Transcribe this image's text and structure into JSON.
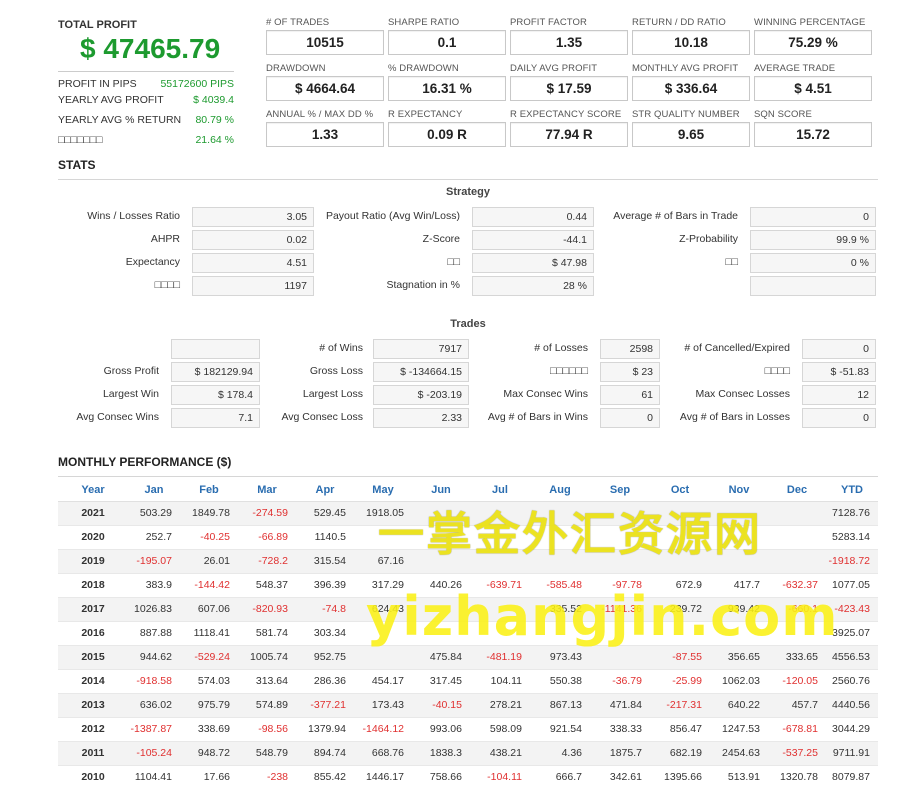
{
  "summary": {
    "total_profit_label": "TOTAL PROFIT",
    "total_profit_value": "$ 47465.79",
    "rows": [
      {
        "label": "PROFIT IN PIPS",
        "value": "55172600 PIPS"
      },
      {
        "label": "YEARLY AVG PROFIT",
        "value": "$ 4039.4"
      },
      {
        "label": "YEARLY AVG % RETURN",
        "value": "80.79 %"
      },
      {
        "label": "□□□□□□□",
        "value": "21.64 %"
      }
    ]
  },
  "cards": [
    {
      "label": "# OF TRADES",
      "value": "10515"
    },
    {
      "label": "SHARPE RATIO",
      "value": "0.1"
    },
    {
      "label": "PROFIT FACTOR",
      "value": "1.35"
    },
    {
      "label": "RETURN / DD RATIO",
      "value": "10.18"
    },
    {
      "label": "WINNING PERCENTAGE",
      "value": "75.29 %"
    },
    {
      "label": "DRAWDOWN",
      "value": "$ 4664.64"
    },
    {
      "label": "% DRAWDOWN",
      "value": "16.31 %"
    },
    {
      "label": "DAILY AVG PROFIT",
      "value": "$ 17.59"
    },
    {
      "label": "MONTHLY AVG PROFIT",
      "value": "$ 336.64"
    },
    {
      "label": "AVERAGE TRADE",
      "value": "$ 4.51"
    },
    {
      "label": "ANNUAL % / MAX DD %",
      "value": "1.33"
    },
    {
      "label": "R EXPECTANCY",
      "value": "0.09 R"
    },
    {
      "label": "R EXPECTANCY SCORE",
      "value": "77.94 R"
    },
    {
      "label": "STR QUALITY NUMBER",
      "value": "9.65"
    },
    {
      "label": "SQN SCORE",
      "value": "15.72"
    }
  ],
  "stats_title": "STATS",
  "strategy": {
    "title": "Strategy",
    "rows": [
      [
        {
          "label": "Wins / Losses Ratio",
          "value": "3.05"
        },
        {
          "label": "Payout Ratio (Avg Win/Loss)",
          "value": "0.44"
        },
        {
          "label": "Average # of Bars in Trade",
          "value": "0"
        }
      ],
      [
        {
          "label": "AHPR",
          "value": "0.02"
        },
        {
          "label": "Z-Score",
          "value": "-44.1"
        },
        {
          "label": "Z-Probability",
          "value": "99.9 %"
        }
      ],
      [
        {
          "label": "Expectancy",
          "value": "4.51"
        },
        {
          "label": "□□",
          "value": "$ 47.98"
        },
        {
          "label": "□□",
          "value": "0 %"
        }
      ],
      [
        {
          "label": "□□□□",
          "value": "1197"
        },
        {
          "label": "Stagnation in %",
          "value": "28 %"
        },
        {
          "label": "",
          "value": ""
        }
      ]
    ]
  },
  "trades": {
    "title": "Trades",
    "rows": [
      [
        {
          "label": "",
          "value": ""
        },
        {
          "label": "# of Wins",
          "value": "7917"
        },
        {
          "label": "# of Losses",
          "value": "2598"
        },
        {
          "label": "# of Cancelled/Expired",
          "value": "0"
        }
      ],
      [
        {
          "label": "Gross Profit",
          "value": "$ 182129.94"
        },
        {
          "label": "Gross Loss",
          "value": "$ -134664.15"
        },
        {
          "label": "□□□□□□",
          "value": "$ 23"
        },
        {
          "label": "□□□□",
          "value": "$ -51.83"
        }
      ],
      [
        {
          "label": "Largest Win",
          "value": "$ 178.4"
        },
        {
          "label": "Largest Loss",
          "value": "$ -203.19"
        },
        {
          "label": "Max Consec Wins",
          "value": "61"
        },
        {
          "label": "Max Consec Losses",
          "value": "12"
        }
      ],
      [
        {
          "label": "Avg Consec Wins",
          "value": "7.1"
        },
        {
          "label": "Avg Consec Loss",
          "value": "2.33"
        },
        {
          "label": "Avg # of Bars in Wins",
          "value": "0"
        },
        {
          "label": "Avg # of Bars in Losses",
          "value": "0"
        }
      ]
    ]
  },
  "monthly": {
    "title": "MONTHLY PERFORMANCE ($)",
    "headers": [
      "Year",
      "Jan",
      "Feb",
      "Mar",
      "Apr",
      "May",
      "Jun",
      "Jul",
      "Aug",
      "Sep",
      "Oct",
      "Nov",
      "Dec",
      "YTD"
    ],
    "rows": [
      [
        "2021",
        "503.29",
        "1849.78",
        "-274.59",
        "529.45",
        "1918.05",
        "",
        "",
        "",
        "",
        "",
        "",
        "",
        "7128.76"
      ],
      [
        "2020",
        "252.7",
        "-40.25",
        "-66.89",
        "1140.5",
        "",
        "",
        "",
        "",
        "",
        "",
        "",
        "",
        "5283.14"
      ],
      [
        "2019",
        "-195.07",
        "26.01",
        "-728.2",
        "315.54",
        "67.16",
        "",
        "",
        "",
        "",
        "",
        "",
        "",
        "-1918.72"
      ],
      [
        "2018",
        "383.9",
        "-144.42",
        "548.37",
        "396.39",
        "317.29",
        "440.26",
        "-639.71",
        "-585.48",
        "-97.78",
        "672.9",
        "417.7",
        "-632.37",
        "1077.05"
      ],
      [
        "2017",
        "1026.83",
        "607.06",
        "-820.93",
        "-74.8",
        "624.43",
        "",
        "",
        "335.52",
        "-1141.36",
        "239.72",
        "939.42",
        "-660.1",
        "-423.43"
      ],
      [
        "2016",
        "887.88",
        "1118.41",
        "581.74",
        "303.34",
        "",
        "",
        "",
        "",
        "",
        "",
        "",
        "",
        "3925.07"
      ],
      [
        "2015",
        "944.62",
        "-529.24",
        "1005.74",
        "952.75",
        "",
        "475.84",
        "-481.19",
        "973.43",
        "",
        "-87.55",
        "356.65",
        "333.65",
        "4556.53"
      ],
      [
        "2014",
        "-918.58",
        "574.03",
        "313.64",
        "286.36",
        "454.17",
        "317.45",
        "104.11",
        "550.38",
        "-36.79",
        "-25.99",
        "1062.03",
        "-120.05",
        "2560.76"
      ],
      [
        "2013",
        "636.02",
        "975.79",
        "574.89",
        "-377.21",
        "173.43",
        "-40.15",
        "278.21",
        "867.13",
        "471.84",
        "-217.31",
        "640.22",
        "457.7",
        "4440.56"
      ],
      [
        "2012",
        "-1387.87",
        "338.69",
        "-98.56",
        "1379.94",
        "-1464.12",
        "993.06",
        "598.09",
        "921.54",
        "338.33",
        "856.47",
        "1247.53",
        "-678.81",
        "3044.29"
      ],
      [
        "2011",
        "-105.24",
        "948.72",
        "548.79",
        "894.74",
        "668.76",
        "1838.3",
        "438.21",
        "4.36",
        "1875.7",
        "682.19",
        "2454.63",
        "-537.25",
        "9711.91"
      ],
      [
        "2010",
        "1104.41",
        "17.66",
        "-238",
        "855.42",
        "1446.17",
        "758.66",
        "-104.11",
        "666.7",
        "342.61",
        "1395.66",
        "513.91",
        "1320.78",
        "8079.87"
      ]
    ]
  },
  "watermark": {
    "line1": "一掌金外汇资源网",
    "line2": "yizhangjin.com"
  }
}
